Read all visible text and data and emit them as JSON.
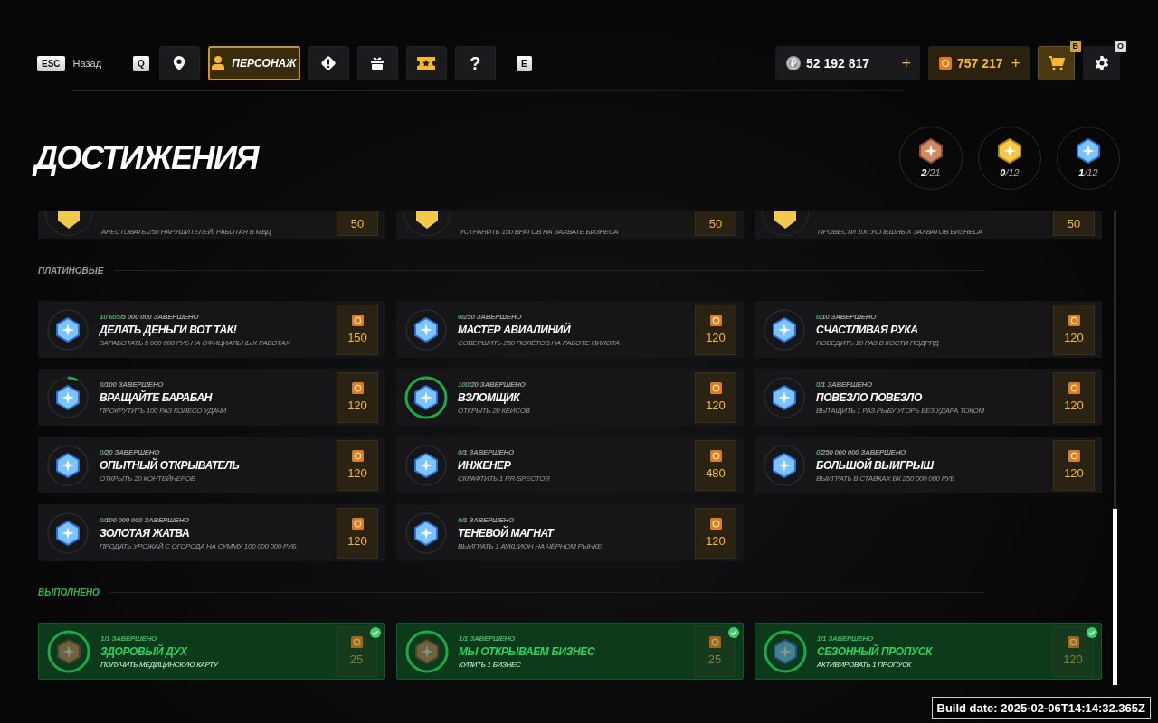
{
  "header": {
    "back": {
      "key": "ESC",
      "label": "Назад"
    },
    "left_key": "Q",
    "right_key": "E",
    "nav": [
      {
        "kind": "pin",
        "selected": false
      },
      {
        "kind": "person",
        "label": "ПЕРСОНАЖ",
        "selected": true
      },
      {
        "kind": "alert",
        "selected": false
      },
      {
        "kind": "gift",
        "selected": false
      },
      {
        "kind": "ticket",
        "selected": false
      },
      {
        "kind": "help",
        "label": "?",
        "selected": false
      }
    ],
    "money": {
      "amount": "52 192 817",
      "plus": "+"
    },
    "donate": {
      "amount": "757 217",
      "plus": "+"
    },
    "shop_key": "B",
    "settings_key": "O"
  },
  "title": "ДОСТИЖЕНИЯ",
  "counters": [
    {
      "kind": "bronze",
      "done": "2",
      "total": "/21"
    },
    {
      "kind": "gold",
      "done": "0",
      "total": "/12"
    },
    {
      "kind": "platinum",
      "done": "1",
      "total": "/12"
    }
  ],
  "clipped_cards": [
    {
      "kind": "gold",
      "description": "АРЕСТОВАТЬ 250 НАРУШИТЕЛЕЙ, РАБОТАЯ В МВД",
      "reward": "50"
    },
    {
      "kind": "gold",
      "description": "УСТРАНИТЬ 150 ВРАГОВ НА ЗАХВАТЕ БИЗНЕСА",
      "reward": "50"
    },
    {
      "kind": "gold",
      "description": "ПРОВЕСТИ 100 УСПЕШНЫХ ЗАХВАТОВ БИЗНЕСА",
      "reward": "50"
    }
  ],
  "sections": [
    {
      "title": "ПЛАТИНОВЫЕ",
      "completed": false,
      "cards": [
        {
          "kind": "platinum",
          "done": "10 605",
          "total": "/5 000 000 ЗАВЕРШЕНО",
          "title": "ДЕЛАТЬ ДЕНЬГИ ВОТ ТАК!",
          "description": "ЗАРАБОТАТЬ 5 000 000 РУБ НА ОФИЦИАЛЬНЫХ РАБОТАХ",
          "reward": "150"
        },
        {
          "kind": "platinum",
          "done": "0",
          "total": "/250 ЗАВЕРШЕНО",
          "title": "МАСТЕР АВИАЛИНИЙ",
          "description": "СОВЕРШИТЬ 250 ПОЛЁТОВ НА РАБОТЕ ПИЛОТА",
          "reward": "120"
        },
        {
          "kind": "platinum",
          "done": "0",
          "total": "/10 ЗАВЕРШЕНО",
          "title": "СЧАСТЛИВАЯ РУКА",
          "description": "ПОБЕДИТЬ 10 РАЗ В КОСТИ ПОДРЯД",
          "reward": "120"
        },
        {
          "kind": "platinum",
          "done": "8",
          "total": "/100 ЗАВЕРШЕНО",
          "title": "ВРАЩАЙТЕ БАРАБАН",
          "description": "ПРОКРУТИТЬ 100 РАЗ КОЛЕСО УДАЧИ",
          "reward": "120",
          "level": 0.08
        },
        {
          "kind": "platinum",
          "done": "100",
          "total": "/20 ЗАВЕРШЕНО",
          "title": "ВЗЛОМЩИК",
          "description": "ОТКРЫТЬ 20 КЕЙСОВ",
          "reward": "120",
          "level": 1
        },
        {
          "kind": "platinum",
          "done": "0",
          "total": "/1 ЗАВЕРШЕНО",
          "title": "ПОВЕЗЛО ПОВЕЗЛО",
          "description": "ВЫТАЩИТЬ 1 РАЗ РЫБУ УГОРЬ БЕЗ УДАРА ТОКОМ",
          "reward": "120"
        },
        {
          "kind": "platinum",
          "done": "0",
          "total": "/20 ЗАВЕРШЕНО",
          "title": "ОПЫТНЫЙ ОТКРЫВАТЕЛЬ",
          "description": "ОТКРЫТЬ 20 КОНТЕЙНЕРОВ",
          "reward": "120"
        },
        {
          "kind": "platinum",
          "done": "0",
          "total": "/1 ЗАВЕРШЕНО",
          "title": "ИНЖЕНЕР",
          "description": "СКРАФТИТЬ 1 RR-SPECTOR",
          "reward": "480"
        },
        {
          "kind": "platinum",
          "done": "0",
          "total": "/250 000 000 ЗАВЕРШЕНО",
          "title": "БОЛЬШОЙ ВЫИГРЫШ",
          "description": "ВЫИГРАТЬ В СТАВКАХ БК 250 000 000 РУБ",
          "reward": "120"
        },
        {
          "kind": "platinum",
          "done": "0",
          "total": "/100 000 000 ЗАВЕРШЕНО",
          "title": "ЗОЛОТАЯ ЖАТВА",
          "description": "ПРОДАТЬ УРОЖАЙ С ОГОРОДА НА СУММУ 100 000 000 РУБ",
          "reward": "120"
        },
        {
          "kind": "platinum",
          "done": "0",
          "total": "/1 ЗАВЕРШЕНО",
          "title": "ТЕНЕВОЙ МАГНАТ",
          "description": "ВЫИГРАТЬ 1 АУКЦИОН НА ЧЁРНОМ РЫНКЕ",
          "reward": "120"
        }
      ]
    },
    {
      "title": "ВЫПОЛНЕНО",
      "completed": true,
      "cards": [
        {
          "kind": "bronze",
          "done": "1",
          "total": "/1 ЗАВЕРШЕНО",
          "title": "ЗДОРОВЫЙ ДУХ",
          "description": "ПОЛУЧИТЬ МЕДИЦИНСКУЮ КАРТУ",
          "reward": "25",
          "level": 1
        },
        {
          "kind": "bronze",
          "done": "1",
          "total": "/1 ЗАВЕРШЕНО",
          "title": "МЫ ОТКРЫВАЕМ БИЗНЕС",
          "description": "КУПИТЬ 1 БИЗНЕС",
          "reward": "25",
          "level": 1
        },
        {
          "kind": "platinum",
          "done": "1",
          "total": "/1 ЗАВЕРШЕНО",
          "title": "СЕЗОННЫЙ ПРОПУСК",
          "description": "АКТИВИРОВАТЬ 1 ПРОПУСК",
          "reward": "120",
          "level": 1
        }
      ]
    }
  ],
  "build": "Build date: 2025-02-06T14:14:32.365Z"
}
